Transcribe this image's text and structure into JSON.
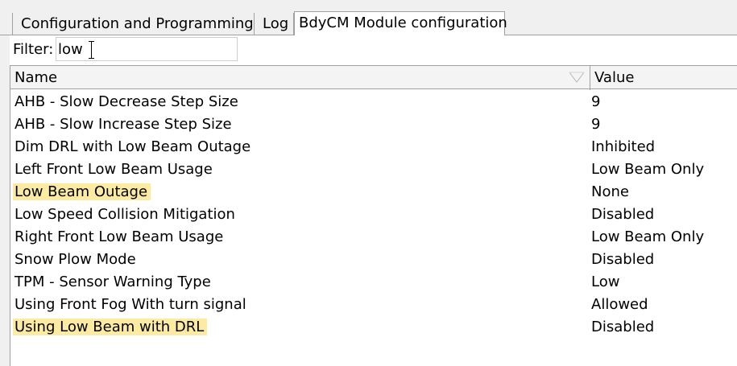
{
  "tabs": [
    {
      "label": "Configuration and Programming",
      "active": false
    },
    {
      "label": "Log",
      "active": false
    },
    {
      "label": "BdyCM Module configuration",
      "active": true
    }
  ],
  "filter": {
    "label": "Filter:",
    "value": "low"
  },
  "table": {
    "columns": [
      "Name",
      "Value"
    ],
    "rows": [
      {
        "name": "AHB - Slow Decrease Step Size",
        "value": "9",
        "highlighted": false
      },
      {
        "name": "AHB - Slow Increase Step Size",
        "value": "9",
        "highlighted": false
      },
      {
        "name": "Dim DRL with Low Beam Outage",
        "value": "Inhibited",
        "highlighted": false
      },
      {
        "name": "Left Front Low Beam Usage",
        "value": "Low Beam Only",
        "highlighted": false
      },
      {
        "name": "Low Beam Outage",
        "value": "None",
        "highlighted": true
      },
      {
        "name": "Low Speed Collision Mitigation",
        "value": "Disabled",
        "highlighted": false
      },
      {
        "name": "Right Front Low Beam Usage",
        "value": "Low Beam Only",
        "highlighted": false
      },
      {
        "name": "Snow Plow Mode",
        "value": "Disabled",
        "highlighted": false
      },
      {
        "name": "TPM - Sensor Warning Type",
        "value": "Low",
        "highlighted": false
      },
      {
        "name": "Using Front Fog With turn signal",
        "value": "Allowed",
        "highlighted": false
      },
      {
        "name": "Using Low Beam with DRL",
        "value": "Disabled",
        "highlighted": true
      }
    ]
  },
  "colors": {
    "highlight": "#fdeba2",
    "chrome": "#f0f0f0",
    "border": "#a0a0a0"
  },
  "icons": {
    "sort": "sort-descending-icon",
    "cursor": "text-cursor-icon"
  }
}
